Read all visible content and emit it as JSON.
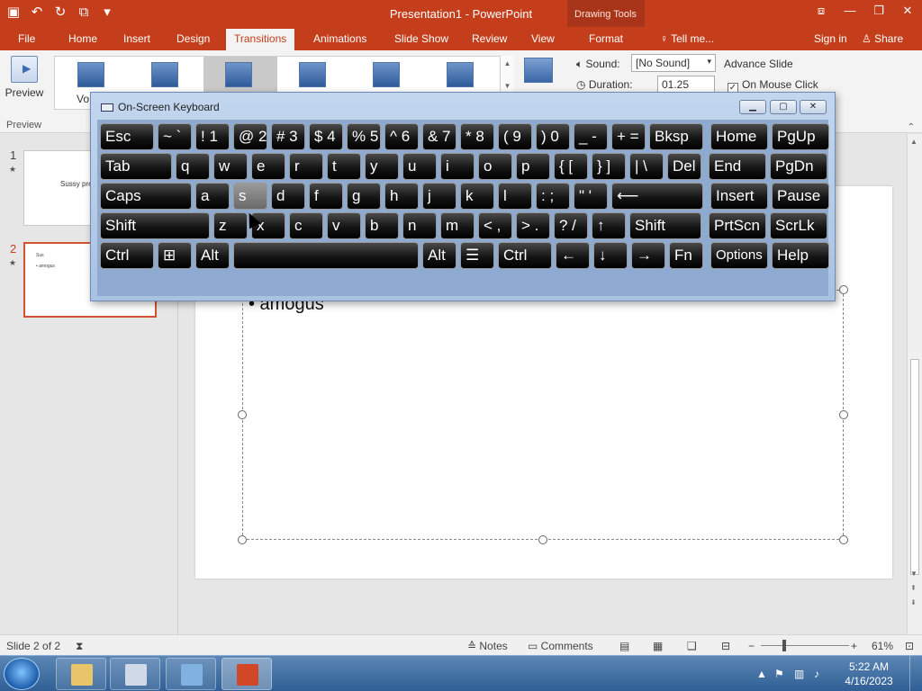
{
  "app": {
    "title": "Presentation1 - PowerPoint",
    "contextual_header": "Drawing Tools"
  },
  "tabs": [
    {
      "label": "File"
    },
    {
      "label": "Home"
    },
    {
      "label": "Insert"
    },
    {
      "label": "Design"
    },
    {
      "label": "Transitions"
    },
    {
      "label": "Animations"
    },
    {
      "label": "Slide Show"
    },
    {
      "label": "Review"
    },
    {
      "label": "View"
    },
    {
      "label": "Format"
    },
    {
      "label": "Tell me..."
    },
    {
      "label": "Sign in"
    },
    {
      "label": "Share"
    }
  ],
  "ribbon": {
    "preview_label": "Preview",
    "preview_group_label": "Preview",
    "gallery_partial_label": "Vo",
    "sound_label": "Sound:",
    "sound_value": "[No Sound]",
    "duration_label": "Duration:",
    "duration_value": "01.25",
    "advance_slide_label": "Advance Slide",
    "on_mouse_click_label": "On Mouse Click"
  },
  "slides": [
    {
      "number": "1",
      "preview_text": "Sussy pre"
    },
    {
      "number": "2",
      "preview_title": "Sus",
      "preview_bullet": "• amogus"
    }
  ],
  "slide": {
    "bullet_text": "• amogus"
  },
  "osk": {
    "title": "On-Screen Keyboard",
    "rows": [
      [
        "Esc",
        "~ `",
        "! 1",
        "@ 2",
        "# 3",
        "$ 4",
        "% 5",
        "^ 6",
        "& 7",
        "* 8",
        "( 9",
        ") 0",
        "_ -",
        "+ =",
        "Bksp",
        "Home",
        "PgUp"
      ],
      [
        "Tab",
        "q",
        "w",
        "e",
        "r",
        "t",
        "y",
        "u",
        "i",
        "o",
        "p",
        "{ [",
        "} ]",
        "| \\",
        "Del",
        "End",
        "PgDn"
      ],
      [
        "Caps",
        "a",
        "s",
        "d",
        "f",
        "g",
        "h",
        "j",
        "k",
        "l",
        ": ;",
        "\" '",
        "⟵",
        "Insert",
        "Pause"
      ],
      [
        "Shift",
        "z",
        "x",
        "c",
        "v",
        "b",
        "n",
        "m",
        "< ,",
        "> .",
        "? /",
        "↑",
        "Shift",
        "PrtScn",
        "ScrLk"
      ],
      [
        "Ctrl",
        "⊞",
        "Alt",
        "",
        "Alt",
        "☰",
        "Ctrl",
        "←",
        "↓",
        "→",
        "Fn",
        "Options",
        "Help"
      ]
    ]
  },
  "status": {
    "slide_counter": "Slide 2 of 2",
    "notes_label": "Notes",
    "comments_label": "Comments",
    "zoom_level": "61%"
  },
  "taskbar": {
    "time": "5:22 AM",
    "date": "4/16/2023"
  },
  "colors": {
    "accent": "#c43e1c",
    "key_face": "#151515",
    "osk_frame": "#a9c2e2"
  }
}
